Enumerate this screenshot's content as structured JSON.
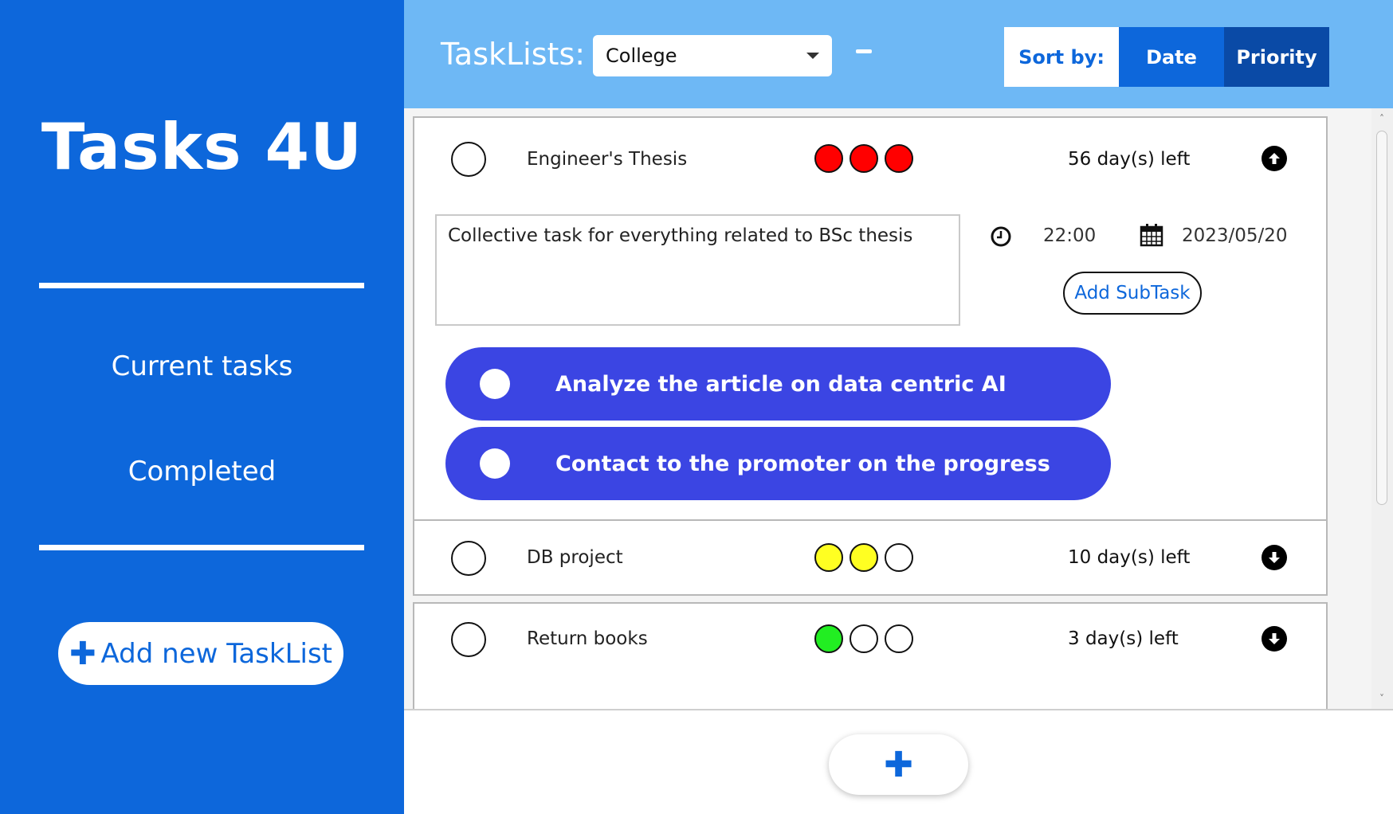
{
  "sidebar": {
    "app_title": "Tasks 4U",
    "nav": [
      "Current tasks",
      "Completed"
    ],
    "add_tasklist_label": "Add new TaskList"
  },
  "header": {
    "tasklists_label": "TaskLists:",
    "selected_tasklist": "College",
    "sort_label": "Sort by:",
    "sort_options": [
      "Date",
      "Priority"
    ],
    "active_sort": "Priority"
  },
  "tasks": [
    {
      "name": "Engineer's Thesis",
      "priority": 3,
      "priority_color": "#ff0000",
      "days_left": "56 day(s) left",
      "expanded": true,
      "description": "Collective task for everything related to BSc thesis",
      "time": "22:00",
      "date": "2023/05/20",
      "add_subtask_label": "Add SubTask",
      "subtasks": [
        "Analyze the article on data centric AI",
        "Contact to the promoter on the progress"
      ]
    },
    {
      "name": "DB project",
      "priority": 2,
      "priority_color": "#ffff22",
      "days_left": "10 day(s) left",
      "expanded": false
    },
    {
      "name": "Return books",
      "priority": 1,
      "priority_color": "#22ee22",
      "days_left": "3 day(s) left",
      "expanded": false
    }
  ],
  "colors": {
    "sidebar_bg": "#0d67db",
    "header_bg": "#6eb8f5",
    "subtask_bg": "#3b45e3",
    "sort_active_bg": "#0a4aa6"
  },
  "icons": {
    "collapse": "arrow-up-circle-icon",
    "expand": "arrow-down-circle-icon",
    "clock": "clock-icon",
    "calendar": "calendar-icon",
    "add": "plus-icon"
  }
}
